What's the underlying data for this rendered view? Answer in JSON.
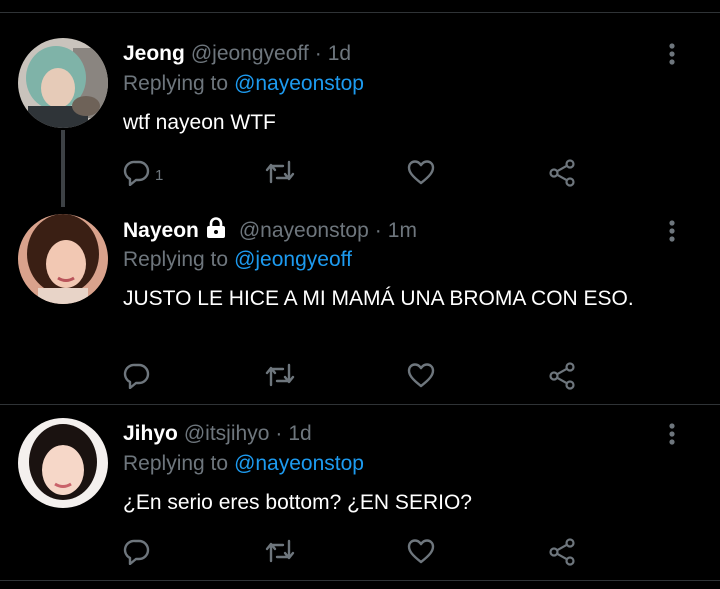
{
  "tweets": [
    {
      "name": "Jeong",
      "handle": "@jeongyeoff",
      "separator": "·",
      "time": "1d",
      "replying_prefix": "Replying to",
      "replying_to": "@nayeonstop",
      "text": "wtf nayeon WTF",
      "reply_count": "1",
      "locked": false,
      "avatar_hair": "#7fb3a8"
    },
    {
      "name": "Nayeon",
      "handle": "@nayeonstop",
      "separator": "·",
      "time": "1m",
      "replying_prefix": "Replying to",
      "replying_to": "@jeongyeoff",
      "text": "JUSTO LE HICE A MI MAMÁ UNA BROMA CON ESO.",
      "reply_count": "",
      "locked": true,
      "avatar_hair": "#3a1f14"
    },
    {
      "name": "Jihyo",
      "handle": "@itsjihyo",
      "separator": "·",
      "time": "1d",
      "replying_prefix": "Replying to",
      "replying_to": "@nayeonstop",
      "text": "¿En serio eres bottom? ¿EN SERIO?",
      "reply_count": "",
      "locked": false,
      "avatar_hair": "#1a1210"
    }
  ],
  "icons": {
    "reply": "reply-icon",
    "retweet": "retweet-icon",
    "like": "heart-icon",
    "share": "share-icon",
    "more": "more-vertical-icon",
    "lock": "lock-icon"
  },
  "colors": {
    "background": "#000000",
    "text": "#ffffff",
    "muted": "#6e767d",
    "mention": "#1d9bf0",
    "divider": "#2f3336"
  }
}
